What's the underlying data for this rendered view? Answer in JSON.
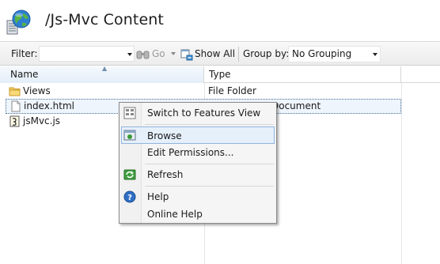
{
  "header": {
    "title": "/Js-Mvc Content",
    "icon": "site-globe-icon"
  },
  "toolbar": {
    "filter_label": "Filter:",
    "filter_value": "",
    "go_label": "Go",
    "show_all_label": "Show All",
    "group_by_label": "Group by:",
    "group_by_value": "No Grouping"
  },
  "grid": {
    "columns": [
      "Name",
      "Type"
    ],
    "rows": [
      {
        "name": "Views",
        "type": "File Folder",
        "icon": "folder-icon"
      },
      {
        "name": "index.html",
        "type": "Document",
        "icon": "html-file-icon"
      },
      {
        "name": "jsMvc.js",
        "type": "",
        "icon": "js-file-icon"
      }
    ]
  },
  "context_menu": {
    "items": [
      {
        "label": "Switch to Features View",
        "icon": "features-view-icon"
      },
      {
        "label": "Browse",
        "icon": "browse-icon"
      },
      {
        "label": "Edit Permissions...",
        "icon": ""
      },
      {
        "label": "Refresh",
        "icon": "refresh-icon"
      },
      {
        "label": "Help",
        "icon": "help-icon"
      },
      {
        "label": "Online Help",
        "icon": ""
      }
    ]
  },
  "colors": {
    "selection_background": "#eef5fc",
    "menu_highlight": "#e6f0fb",
    "header_gradient_end": "#e3eef9"
  }
}
